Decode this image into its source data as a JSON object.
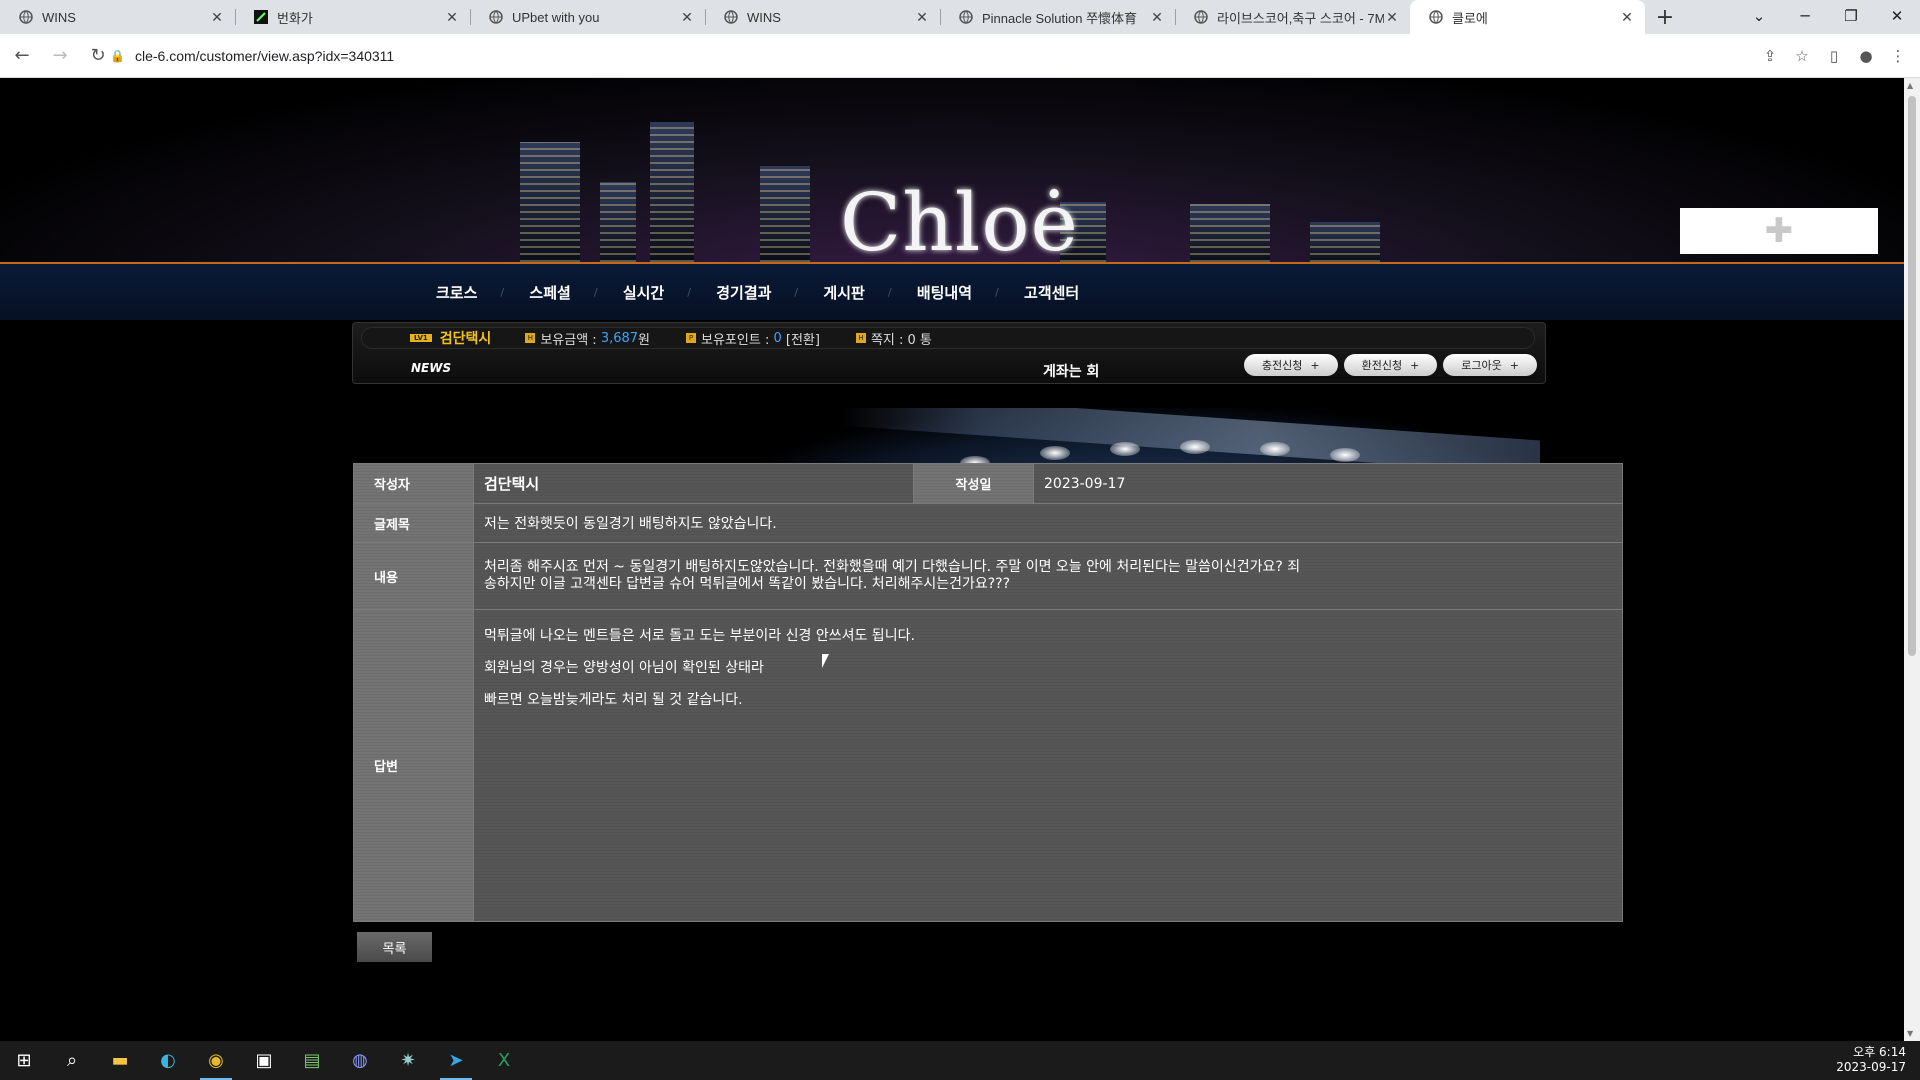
{
  "browser": {
    "tabs": [
      {
        "title": "WINS",
        "icon": "globe-icon"
      },
      {
        "title": "번화가",
        "icon": "site-icon"
      },
      {
        "title": "UPbet with you",
        "icon": "globe-icon"
      },
      {
        "title": "WINS",
        "icon": "globe-icon"
      },
      {
        "title": "Pinnacle Solution 쭈懷体育",
        "icon": "globe-icon"
      },
      {
        "title": "라이브스코어,축구 스코어 - 7M",
        "icon": "globe-icon"
      },
      {
        "title": "클로에",
        "icon": "globe-icon",
        "active": true
      }
    ],
    "url": "cle-6.com/customer/view.asp?idx=340311"
  },
  "site": {
    "logo": "Chloė",
    "menu": [
      "크로스",
      "스페셜",
      "실시간",
      "경기결과",
      "게시판",
      "배팅내역",
      "고객센터"
    ],
    "user": {
      "level": "LV1",
      "name": "검단택시",
      "balance_label": "보유금액 :",
      "balance": "3,687",
      "balance_unit": "원",
      "points_label": "보유포인트 :",
      "points": "0",
      "convert": "[전환]",
      "msg_label": "쪽지 : 0 통"
    },
    "news_label": "NEWS",
    "news_ticker": "게좌는 회",
    "buttons": [
      "충전신청",
      "환전신청",
      "로그아웃"
    ]
  },
  "board": {
    "author_label": "작성자",
    "author": "검단택시",
    "date_label": "작성일",
    "date": "2023-09-17",
    "title_label": "글제목",
    "title": "저는 전화햇듯이 동일경기 배팅하지도 않았습니다.",
    "content_label": "내용",
    "content_line1": "처리좀 해주시죠 먼저 ~ 동일경기 배팅하지도않았습니다. 전화했을때 예기 다했습니다. 주말 이면 오늘 안에 처리된다는 말씀이신건가요? 죄",
    "content_line2": "송하지만 이글 고객센타 답변글 슈어 먹튀글에서 똑같이 봤습니다. 처리해주시는건가요???",
    "answer_label": "답변",
    "answers": [
      "먹튀글에 나오는 멘트들은 서로 돌고 도는 부분이라 신경 안쓰셔도 됩니다.",
      "회원님의 경우는 양방성이 아님이 확인된 상태라",
      "빠르면 오늘밤늦게라도 처리 될 것 같습니다."
    ],
    "list_button": "목록"
  },
  "taskbar": {
    "time": "오후 6:14",
    "date": "2023-09-17"
  }
}
